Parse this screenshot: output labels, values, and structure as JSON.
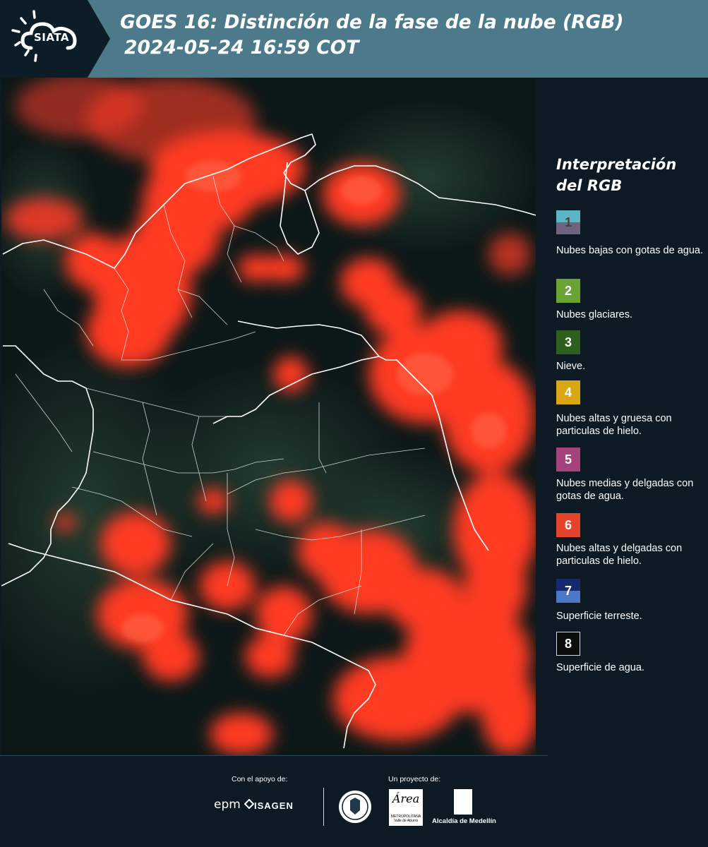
{
  "header": {
    "logo_text": "SIATA",
    "title_line1": "GOES 16: Distinción de la fase de la nube (RGB)",
    "title_line2": "2024-05-24 16:59 COT"
  },
  "legend": {
    "title": "Interpretación del RGB",
    "items": [
      {
        "num": "1",
        "label": "Nubes bajas con gotas de agua.",
        "colors": [
          "#5cb5c4",
          "#6e6480"
        ]
      },
      {
        "num": "2",
        "label": "Nubes glaciares.",
        "colors": [
          "#6aa333"
        ]
      },
      {
        "num": "3",
        "label": "Nieve.",
        "colors": [
          "#2e5f1e"
        ]
      },
      {
        "num": "4",
        "label": "Nubes altas y gruesa con particulas de hielo.",
        "colors": [
          "#d9a715"
        ]
      },
      {
        "num": "5",
        "label": "Nubes medias y delgadas con gotas de agua.",
        "colors": [
          "#a5437c"
        ]
      },
      {
        "num": "6",
        "label": "Nubes altas y delgadas con particulas de hielo.",
        "colors": [
          "#e4442b"
        ]
      },
      {
        "num": "7",
        "label": "Superficie terreste.",
        "colors": [
          "#152a6e",
          "#4c78c8"
        ]
      },
      {
        "num": "8",
        "label": "Superficie de agua.",
        "colors": [
          "#0a0f0e"
        ]
      }
    ]
  },
  "footer": {
    "support_label": "Con el apoyo de:",
    "project_label": "Un proyecto de:",
    "epm": "epm",
    "isagen": "ISAGEN",
    "area_text": "Área",
    "area_sub": "METROPOLITANA Valle de Aburrá",
    "alcaldia": "Alcaldía de Medellín"
  },
  "colors": {
    "header_band": "#4d7a8a",
    "background": "#0d1a24",
    "cloud": "#ff3b24"
  }
}
